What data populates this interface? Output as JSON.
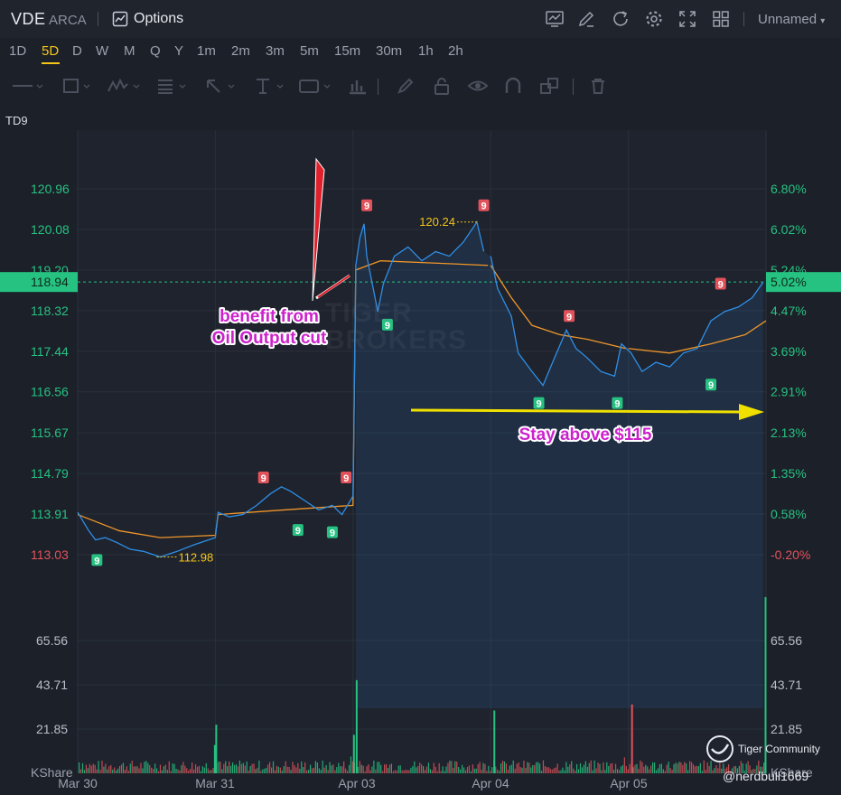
{
  "header": {
    "symbol": "VDE",
    "exchange": "ARCA",
    "options_label": "Options",
    "layout_name": "Unnamed"
  },
  "timeframes": [
    "1D",
    "5D",
    "D",
    "W",
    "M",
    "Q",
    "Y",
    "1m",
    "2m",
    "3m",
    "5m",
    "15m",
    "30m",
    "1h",
    "2h"
  ],
  "active_timeframe": "5D",
  "indicator_label": "TD9",
  "watermark": [
    "TIGER",
    "BROKERS"
  ],
  "community_label": "Tiger Community",
  "author": "@nerdbull1669",
  "volume_source": "KShare",
  "colors": {
    "up": "#26c281",
    "down": "#e2525a",
    "price_line": "#2f8ee6",
    "avg_line": "#f0962a",
    "annotation": "#cc22cc",
    "arrow": "#f0e000"
  },
  "chart_data": {
    "type": "line",
    "x_ticks": [
      "Mar 30",
      "Mar 31",
      "Apr 03",
      "Apr 04",
      "Apr 05"
    ],
    "ylim": [
      112.59,
      121.4
    ],
    "price_ticks": [
      "120.96",
      "120.08",
      "119.20",
      "118.32",
      "117.44",
      "116.56",
      "115.67",
      "114.79",
      "113.91",
      "113.03"
    ],
    "pct_ticks": [
      "6.80%",
      "6.02%",
      "5.24%",
      "4.47%",
      "3.69%",
      "2.91%",
      "2.13%",
      "1.35%",
      "0.58%",
      "-0.20%"
    ],
    "prev_close": 113.25,
    "last_price": "118.94",
    "last_pct": "5.02%",
    "volume_ticks": [
      "65.56",
      "43.71",
      "21.85"
    ],
    "volume_max": 87.4,
    "series": [
      {
        "values": [
          [
            0,
            113.95
          ],
          [
            0.03,
            113.8
          ],
          [
            0.08,
            113.55
          ],
          [
            0.13,
            113.35
          ],
          [
            0.2,
            113.4
          ],
          [
            0.28,
            113.3
          ],
          [
            0.38,
            113.15
          ],
          [
            0.48,
            113.1
          ],
          [
            0.6,
            112.98
          ],
          [
            0.72,
            113.1
          ],
          [
            0.85,
            113.25
          ],
          [
            1.0,
            113.4
          ],
          [
            1.02,
            113.95
          ],
          [
            1.1,
            113.85
          ],
          [
            1.2,
            113.9
          ],
          [
            1.3,
            114.1
          ],
          [
            1.4,
            114.35
          ],
          [
            1.48,
            114.5
          ],
          [
            1.55,
            114.4
          ],
          [
            1.65,
            114.2
          ],
          [
            1.75,
            114.0
          ],
          [
            1.85,
            114.1
          ],
          [
            1.92,
            113.9
          ],
          [
            2.0,
            114.3
          ],
          [
            2.02,
            119.3
          ],
          [
            2.05,
            119.9
          ],
          [
            2.08,
            120.2
          ],
          [
            2.1,
            119.5
          ],
          [
            2.14,
            118.9
          ],
          [
            2.18,
            118.3
          ],
          [
            2.22,
            118.9
          ],
          [
            2.3,
            119.5
          ],
          [
            2.4,
            119.7
          ],
          [
            2.5,
            119.4
          ],
          [
            2.6,
            119.6
          ],
          [
            2.7,
            119.5
          ],
          [
            2.8,
            119.8
          ],
          [
            2.9,
            120.24
          ],
          [
            2.95,
            119.6
          ],
          [
            3.0,
            119.5
          ],
          [
            3.05,
            118.8
          ],
          [
            3.15,
            118.2
          ],
          [
            3.2,
            117.4
          ],
          [
            3.3,
            117.0
          ],
          [
            3.38,
            116.7
          ],
          [
            3.45,
            117.2
          ],
          [
            3.55,
            117.9
          ],
          [
            3.62,
            117.5
          ],
          [
            3.7,
            117.3
          ],
          [
            3.8,
            117.0
          ],
          [
            3.9,
            116.9
          ],
          [
            3.95,
            117.6
          ],
          [
            4.02,
            117.4
          ],
          [
            4.1,
            117.0
          ],
          [
            4.2,
            117.2
          ],
          [
            4.3,
            117.1
          ],
          [
            4.4,
            117.4
          ],
          [
            4.5,
            117.5
          ],
          [
            4.6,
            118.1
          ],
          [
            4.7,
            118.3
          ],
          [
            4.8,
            118.4
          ],
          [
            4.9,
            118.6
          ],
          [
            4.98,
            118.94
          ]
        ]
      },
      {
        "values": [
          [
            0,
            113.9
          ],
          [
            0.3,
            113.55
          ],
          [
            0.6,
            113.4
          ],
          [
            1.0,
            113.45
          ],
          [
            1.02,
            113.9
          ],
          [
            1.5,
            114.0
          ],
          [
            2.0,
            114.1
          ],
          [
            2.02,
            119.2
          ],
          [
            2.2,
            119.4
          ],
          [
            2.6,
            119.35
          ],
          [
            2.98,
            119.3
          ],
          [
            3.0,
            119.3
          ],
          [
            3.15,
            118.6
          ],
          [
            3.3,
            118.0
          ],
          [
            3.5,
            117.8
          ],
          [
            3.7,
            117.7
          ],
          [
            3.98,
            117.5
          ],
          [
            4.0,
            117.5
          ],
          [
            4.3,
            117.4
          ],
          [
            4.6,
            117.6
          ],
          [
            4.85,
            117.8
          ],
          [
            5.0,
            118.1
          ]
        ]
      }
    ],
    "td9": [
      {
        "x": 0.14,
        "y": 113.2,
        "dir": "down"
      },
      {
        "x": 1.35,
        "y": 114.4,
        "dir": "up"
      },
      {
        "x": 1.6,
        "y": 113.85,
        "dir": "down"
      },
      {
        "x": 1.85,
        "y": 113.8,
        "dir": "down"
      },
      {
        "x": 1.95,
        "y": 114.4,
        "dir": "up"
      },
      {
        "x": 2.1,
        "y": 120.3,
        "dir": "up"
      },
      {
        "x": 2.25,
        "y": 118.3,
        "dir": "down"
      },
      {
        "x": 2.95,
        "y": 120.3,
        "dir": "up"
      },
      {
        "x": 3.35,
        "y": 116.6,
        "dir": "down"
      },
      {
        "x": 3.57,
        "y": 117.9,
        "dir": "up"
      },
      {
        "x": 3.92,
        "y": 116.6,
        "dir": "down"
      },
      {
        "x": 4.67,
        "y": 118.6,
        "dir": "up"
      },
      {
        "x": 4.6,
        "y": 117.0,
        "dir": "down"
      }
    ],
    "extremes": [
      {
        "label": "120.24",
        "x": 2.9,
        "y": 120.24,
        "side": "left"
      },
      {
        "label": "112.98",
        "x": 0.6,
        "y": 112.98,
        "side": "right"
      }
    ],
    "annotations": [
      {
        "lines": [
          "benefit from",
          "Oil Output cut"
        ],
        "x": 1.5,
        "y": 118.2
      },
      {
        "lines": [
          "Stay above $115"
        ],
        "x": 3.5,
        "y": 115.6
      }
    ],
    "volume_spikes": [
      {
        "x": 0.99,
        "v": 14,
        "dir": "up"
      },
      {
        "x": 1.0,
        "v": 24,
        "dir": "up"
      },
      {
        "x": 2.0,
        "v": 19,
        "dir": "up"
      },
      {
        "x": 2.02,
        "v": 46,
        "dir": "up"
      },
      {
        "x": 3.02,
        "v": 31,
        "dir": "up"
      },
      {
        "x": 4.02,
        "v": 34,
        "dir": "down"
      },
      {
        "x": 4.99,
        "v": 87,
        "dir": "up"
      }
    ]
  }
}
